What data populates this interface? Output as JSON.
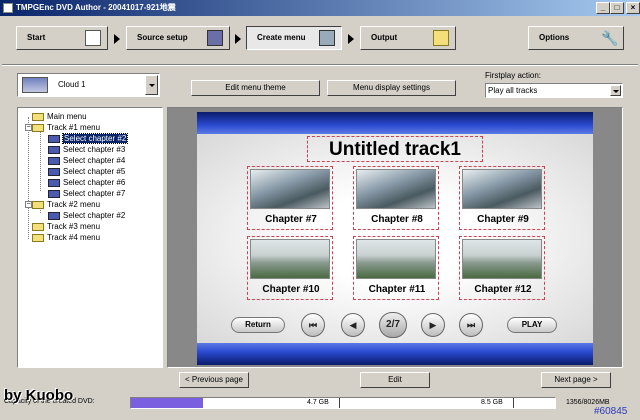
{
  "window": {
    "title": "TMPGEnc DVD Author - 20041017-921地震"
  },
  "wizard": {
    "steps": [
      {
        "label": "Start"
      },
      {
        "label": "Source setup"
      },
      {
        "label": "Create menu"
      },
      {
        "label": "Output"
      }
    ],
    "options_label": "Options"
  },
  "menu_select": {
    "value": "Cloud 1"
  },
  "buttons": {
    "edit_theme": "Edit menu theme",
    "display_settings": "Menu display settings"
  },
  "firstplay": {
    "label": "Firstplay action:",
    "value": "Play all tracks"
  },
  "tree": {
    "main": "Main menu",
    "track1": "Track #1 menu",
    "track1_items": [
      "Select chapter #2",
      "Select chapter #3",
      "Select chapter #4",
      "Select chapter #5",
      "Select chapter #6",
      "Select chapter #7"
    ],
    "track2": "Track #2 menu",
    "track2_items": [
      "Select chapter #2"
    ],
    "track3": "Track #3 menu",
    "track4": "Track #4 menu"
  },
  "preview": {
    "title": "Untitled track1",
    "chapters": [
      "Chapter #7",
      "Chapter #8",
      "Chapter #9",
      "Chapter #10",
      "Chapter #11",
      "Chapter #12"
    ],
    "return_label": "Return",
    "page_indicator": "2/7",
    "play_label": "PLAY"
  },
  "footer": {
    "prev": "< Previous page",
    "edit": "Edit",
    "next": "Next page >"
  },
  "status": {
    "label": "Capacity of the created DVD:",
    "mark1": "4.7 GB",
    "mark2": "8.5 GB",
    "total": "1356/8026MB",
    "fill_fraction": 0.169
  },
  "watermark": "by Kuobo",
  "image_id": "#60845"
}
